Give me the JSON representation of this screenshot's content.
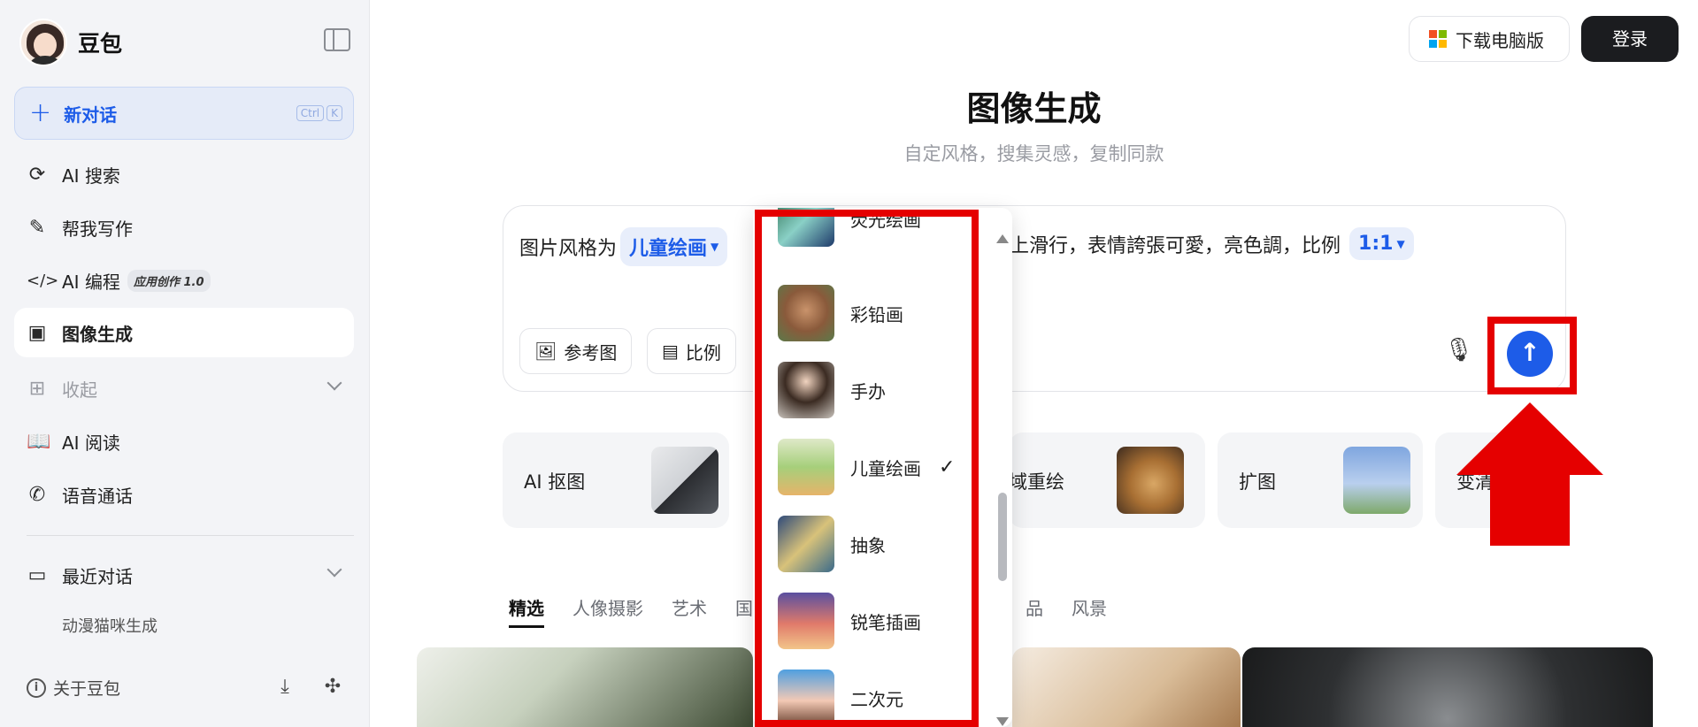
{
  "sidebar": {
    "brand": "豆包",
    "new_chat": {
      "label": "新对话",
      "shortcut": [
        "Ctrl",
        "K"
      ]
    },
    "items": [
      {
        "label": "AI 搜索",
        "icon": "ai-search-icon"
      },
      {
        "label": "帮我写作",
        "icon": "magic-pen-icon"
      },
      {
        "label": "AI 编程",
        "icon": "code-icon",
        "tag": "应用创作 1.0"
      },
      {
        "label": "图像生成",
        "icon": "image-gen-icon"
      },
      {
        "label": "收起",
        "icon": "apps-grid-icon"
      },
      {
        "label": "AI 阅读",
        "icon": "book-icon"
      },
      {
        "label": "语音通话",
        "icon": "phone-icon"
      }
    ],
    "recent": {
      "title": "最近对话",
      "items": [
        "动漫猫咪生成"
      ]
    },
    "footer": {
      "about": "关于豆包"
    }
  },
  "header": {
    "download_label": "下载电脑版",
    "login_label": "登录"
  },
  "main": {
    "title": "图像生成",
    "subtitle": "自定风格，搜集灵感，复制同款",
    "prompt": {
      "prefix": "图片风格为",
      "style_chip": "儿童绘画",
      "tail": "上滑行，表情誇張可愛，亮色調，比例",
      "ratio_chip": "1:1",
      "ref_button": "参考图",
      "ratio_button": "比例"
    },
    "cards": [
      {
        "label": "AI 抠图"
      },
      {
        "label": "域重绘"
      },
      {
        "label": "扩图"
      },
      {
        "label": "变清"
      }
    ],
    "tabs": [
      "精选",
      "人像摄影",
      "艺术",
      "国",
      "品",
      "风景"
    ]
  },
  "dropdown": {
    "options": [
      {
        "name": "荧光绘画"
      },
      {
        "name": "彩铅画"
      },
      {
        "name": "手办"
      },
      {
        "name": "儿童绘画",
        "selected": true
      },
      {
        "name": "抽象"
      },
      {
        "name": "锐笔插画"
      },
      {
        "name": "二次元"
      }
    ]
  },
  "colors": {
    "accent": "#1d5ce8",
    "annotation": "#e50000",
    "sidebar_bg": "#f3f4f7"
  }
}
